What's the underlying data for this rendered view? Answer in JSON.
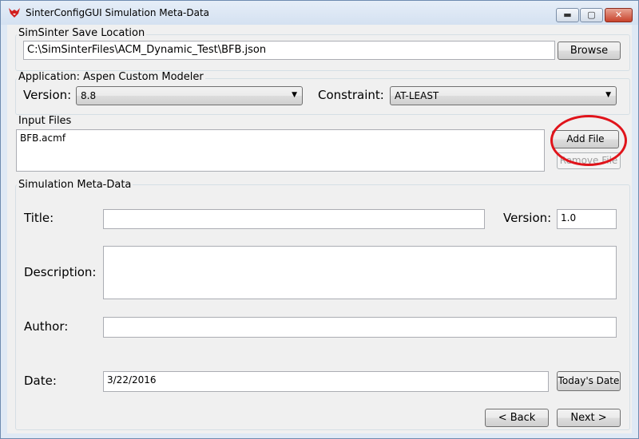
{
  "window": {
    "title": "SinterConfigGUI Simulation Meta-Data",
    "controls": {
      "minimize": "▬",
      "maximize": "▢",
      "close": "✕"
    }
  },
  "save_location": {
    "group_label": "SimSinter Save Location",
    "path": "C:\\SimSinterFiles\\ACM_Dynamic_Test\\BFB.json",
    "browse_label": "Browse"
  },
  "application": {
    "group_label": "Application: Aspen Custom Modeler",
    "version_label": "Version:",
    "version_value": "8.8",
    "constraint_label": "Constraint:",
    "constraint_value": "AT-LEAST"
  },
  "input_files": {
    "group_label": "Input Files",
    "files": [
      "BFB.acmf"
    ],
    "add_label": "Add File",
    "remove_label": "Remove File"
  },
  "meta": {
    "group_label": "Simulation Meta-Data",
    "title_label": "Title:",
    "title_value": "",
    "version_label": "Version:",
    "version_value": "1.0",
    "description_label": "Description:",
    "description_value": "",
    "author_label": "Author:",
    "author_value": "",
    "date_label": "Date:",
    "date_value": "3/22/2016",
    "today_label": "Today's Date"
  },
  "nav": {
    "back_label": "< Back",
    "next_label": "Next >"
  },
  "colors": {
    "highlight": "#e0141b",
    "title_bar": "#dce6f4"
  }
}
